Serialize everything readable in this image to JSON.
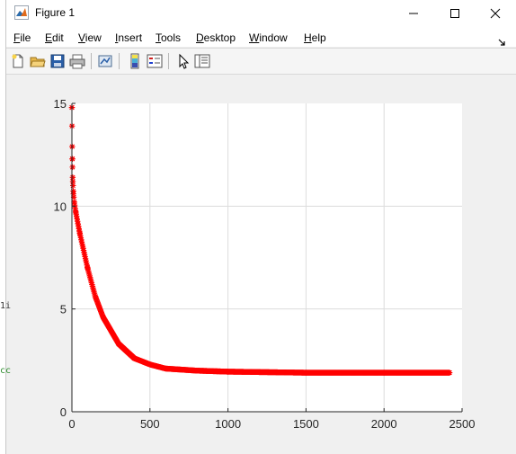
{
  "window": {
    "title": "Figure 1"
  },
  "menu": {
    "items": [
      {
        "label": "File",
        "key": "F",
        "rest": "ile"
      },
      {
        "label": "Edit",
        "key": "E",
        "rest": "dit"
      },
      {
        "label": "View",
        "key": "V",
        "rest": "iew"
      },
      {
        "label": "Insert",
        "key": "I",
        "rest": "nsert"
      },
      {
        "label": "Tools",
        "key": "T",
        "rest": "ools"
      },
      {
        "label": "Desktop",
        "key": "D",
        "rest": "esktop"
      },
      {
        "label": "Window",
        "key": "W",
        "rest": "indow"
      },
      {
        "label": "Help",
        "key": "H",
        "rest": "elp"
      }
    ]
  },
  "toolbar": {
    "icons": [
      "new-figure-icon",
      "open-file-icon",
      "save-icon",
      "print-icon",
      "link-plot-icon",
      "insert-colorbar-icon",
      "insert-legend-icon",
      "edit-plot-arrow-icon",
      "property-inspector-icon"
    ]
  },
  "background_text": {
    "line1": "1i",
    "line2": "cc"
  },
  "colors": {
    "marker": "#ff0000",
    "axes_bg": "#ffffff",
    "figure_bg": "#f0f0f0",
    "grid": "#dcdcdc"
  },
  "chart_data": {
    "type": "scatter",
    "marker": "*",
    "title": "",
    "xlabel": "",
    "ylabel": "",
    "xlim": [
      0,
      2500
    ],
    "ylim": [
      0,
      15
    ],
    "xticks": [
      0,
      500,
      1000,
      1500,
      2000,
      2500
    ],
    "yticks": [
      0,
      5,
      10,
      15
    ],
    "grid": true,
    "series": [
      {
        "color": "#ff0000",
        "x_range": [
          0,
          2420
        ],
        "sample_points": [
          {
            "x": 0,
            "y": 14.8
          },
          {
            "x": 1,
            "y": 13.9
          },
          {
            "x": 2,
            "y": 12.9
          },
          {
            "x": 3,
            "y": 12.3
          },
          {
            "x": 4,
            "y": 11.9
          },
          {
            "x": 5,
            "y": 11.4
          },
          {
            "x": 7,
            "y": 11.0
          },
          {
            "x": 10,
            "y": 10.6
          },
          {
            "x": 15,
            "y": 10.2
          },
          {
            "x": 25,
            "y": 9.7
          },
          {
            "x": 50,
            "y": 8.7
          },
          {
            "x": 100,
            "y": 7.0
          },
          {
            "x": 150,
            "y": 5.6
          },
          {
            "x": 200,
            "y": 4.6
          },
          {
            "x": 300,
            "y": 3.3
          },
          {
            "x": 400,
            "y": 2.6
          },
          {
            "x": 500,
            "y": 2.3
          },
          {
            "x": 600,
            "y": 2.1
          },
          {
            "x": 800,
            "y": 2.0
          },
          {
            "x": 1000,
            "y": 1.95
          },
          {
            "x": 1500,
            "y": 1.9
          },
          {
            "x": 2000,
            "y": 1.9
          },
          {
            "x": 2420,
            "y": 1.9
          }
        ]
      }
    ]
  }
}
